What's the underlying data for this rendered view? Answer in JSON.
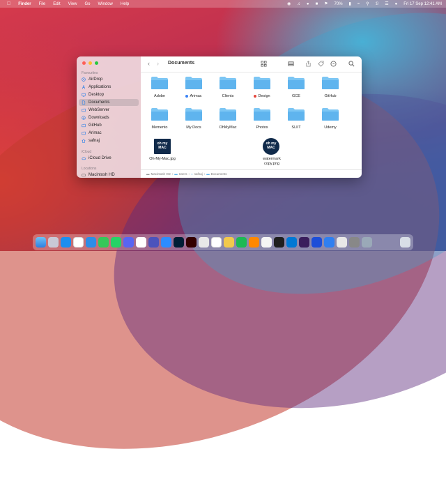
{
  "menubar": {
    "app": "Finder",
    "menus": [
      "File",
      "Edit",
      "View",
      "Go",
      "Window",
      "Help"
    ],
    "battery": "70%",
    "datetime": "Fri 17 Sep  12:41 AM"
  },
  "window": {
    "title": "Documents",
    "sidebar": {
      "favourites_heading": "Favourites",
      "favourites": [
        "AirDrop",
        "Applications",
        "Desktop",
        "Documents",
        "WebServer",
        "Downloads",
        "GitHub",
        "Arimac",
        "safnaj"
      ],
      "icloud_heading": "iCloud",
      "icloud": [
        "iCloud Drive"
      ],
      "locations_heading": "Locations",
      "locations": [
        "Macintosh HD"
      ]
    },
    "items": [
      {
        "name": "Adobe",
        "tag": ""
      },
      {
        "name": "Arimac",
        "tag": "#3b82f6"
      },
      {
        "name": "Clients",
        "tag": ""
      },
      {
        "name": "Design",
        "tag": "#e5483d"
      },
      {
        "name": "GCE",
        "tag": ""
      },
      {
        "name": "GitHub",
        "tag": ""
      },
      {
        "name": "Memento",
        "tag": ""
      },
      {
        "name": "My Docs",
        "tag": ""
      },
      {
        "name": "OhMyMac",
        "tag": ""
      },
      {
        "name": "Photos",
        "tag": ""
      },
      {
        "name": "SLIIT",
        "tag": ""
      },
      {
        "name": "Udemy",
        "tag": ""
      }
    ],
    "files": [
      {
        "name": "Oh-My-Mac.jpg",
        "thumb_text": "oh my\nMAC"
      },
      {
        "name": "watermark copy.png",
        "name_line1": "watermark",
        "name_line2": "copy.png",
        "thumb_text": "oh my\nMAC"
      }
    ],
    "path": [
      "Macintosh HD",
      "Users",
      "safnaj",
      "Documents"
    ]
  },
  "colors": {
    "folder": "#5fb4ee",
    "folder_top": "#7cc6f4",
    "selection": "#b6a6ae"
  }
}
